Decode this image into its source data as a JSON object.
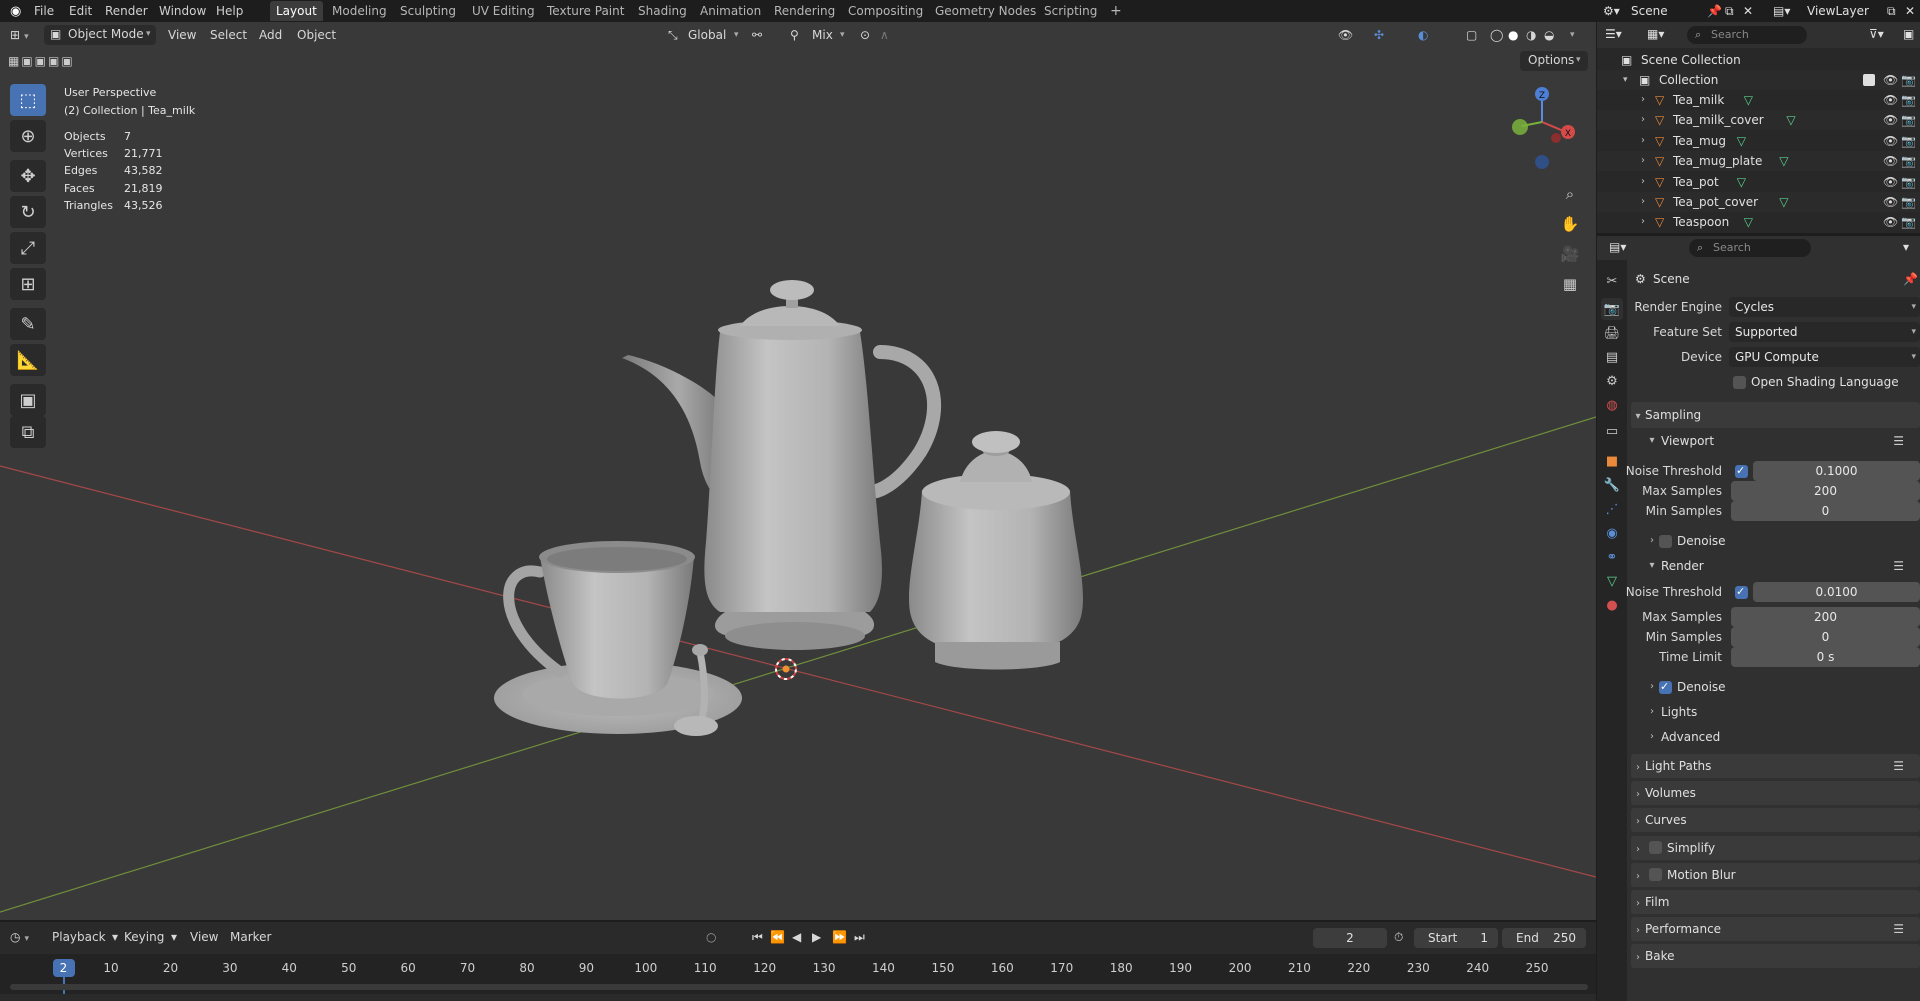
{
  "menubar": {
    "items": [
      "File",
      "Edit",
      "Render",
      "Window",
      "Help"
    ],
    "workspace_tabs": [
      "Layout",
      "Modeling",
      "Sculpting",
      "UV Editing",
      "Texture Paint",
      "Shading",
      "Animation",
      "Rendering",
      "Compositing",
      "Geometry Nodes",
      "Scripting"
    ],
    "active_tab": "Layout",
    "scene_name": "Scene",
    "view_layer": "ViewLayer"
  },
  "viewport": {
    "mode": "Object Mode",
    "menus": [
      "View",
      "Select",
      "Add",
      "Object"
    ],
    "orientation": "Global",
    "snap_mode": "Mix",
    "options_label": "Options",
    "perspective": "User Perspective",
    "collection_info": "(2) Collection | Tea_milk",
    "stats": [
      {
        "label": "Objects",
        "value": "7"
      },
      {
        "label": "Vertices",
        "value": "21,771"
      },
      {
        "label": "Edges",
        "value": "43,582"
      },
      {
        "label": "Faces",
        "value": "21,819"
      },
      {
        "label": "Triangles",
        "value": "43,526"
      }
    ],
    "gizmo_axes": [
      "Z",
      "X"
    ]
  },
  "timeline": {
    "menus": [
      "Playback",
      "Keying",
      "View",
      "Marker"
    ],
    "current_frame": "2",
    "start_label": "Start",
    "start": "1",
    "end_label": "End",
    "end": "250",
    "ruler_ticks": [
      "10",
      "20",
      "30",
      "40",
      "50",
      "60",
      "70",
      "80",
      "90",
      "100",
      "110",
      "120",
      "130",
      "140",
      "150",
      "160",
      "170",
      "180",
      "190",
      "200",
      "210",
      "220",
      "230",
      "240",
      "250"
    ]
  },
  "outliner": {
    "search_placeholder": "Search",
    "root": "Scene Collection",
    "collection": "Collection",
    "objects": [
      "Tea_milk",
      "Tea_milk_cover",
      "Tea_mug",
      "Tea_mug_plate",
      "Tea_pot",
      "Tea_pot_cover",
      "Teaspoon"
    ]
  },
  "properties": {
    "search_placeholder": "Search",
    "context": "Scene",
    "render_engine_label": "Render Engine",
    "render_engine": "Cycles",
    "feature_set_label": "Feature Set",
    "feature_set": "Supported",
    "device_label": "Device",
    "device": "GPU Compute",
    "osl_label": "Open Shading Language",
    "sampling": {
      "title": "Sampling",
      "viewport": {
        "title": "Viewport",
        "noise_threshold_label": "Noise Threshold",
        "noise_threshold": "0.1000",
        "max_samples_label": "Max Samples",
        "max_samples": "200",
        "min_samples_label": "Min Samples",
        "min_samples": "0",
        "denoise_label": "Denoise"
      },
      "render": {
        "title": "Render",
        "noise_threshold_label": "Noise Threshold",
        "noise_threshold": "0.0100",
        "max_samples_label": "Max Samples",
        "max_samples": "200",
        "min_samples_label": "Min Samples",
        "min_samples": "0",
        "time_limit_label": "Time Limit",
        "time_limit": "0 s",
        "denoise_label": "Denoise"
      },
      "lights": "Lights",
      "advanced": "Advanced"
    },
    "panels": [
      "Light Paths",
      "Volumes",
      "Curves",
      "Simplify",
      "Motion Blur",
      "Film",
      "Performance",
      "Bake"
    ]
  },
  "colors": {
    "accent": "#4772b3",
    "viewport_bg": "#393939",
    "x_axis": "#b04848",
    "y_axis": "#6f8f3a"
  }
}
